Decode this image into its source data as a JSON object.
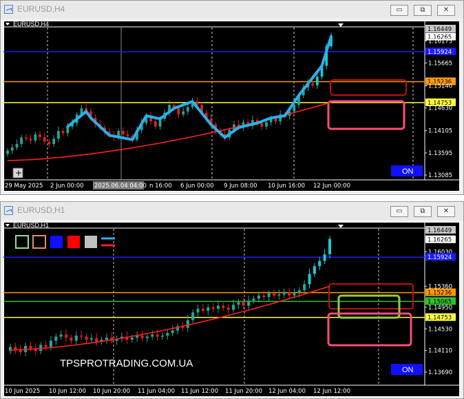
{
  "windows": [
    {
      "id": "h4",
      "title": "EURUSD,H4",
      "symbol_label": "EURUSD,H4",
      "buttons": {
        "minimize": "▭",
        "restore": "⧉",
        "close": "✕"
      },
      "price_scale": [
        "1.16449",
        "1.16265",
        "1.16175",
        "1.15924",
        "1.15665",
        "1.15236",
        "1.15140",
        "1.14753",
        "1.14630",
        "1.14105",
        "1.13595",
        "1.13085"
      ],
      "time_axis": [
        "29 May 2025",
        "2 Jun 00:00",
        "2025.06.04 04:00",
        "n 16:00",
        "6 Jun 00:00",
        "9 Jun 08:00",
        "10 Jun 16:00",
        "12 Jun 00:00"
      ],
      "levels": {
        "blue": "1.15924",
        "orange": "1.15236",
        "yellow": "1.14753"
      },
      "on_button": "ON",
      "chart_data": {
        "type": "candlestick",
        "ylim": [
          1.13085,
          1.16449
        ],
        "closes": [
          1.1365,
          1.1372,
          1.138,
          1.1395,
          1.1392,
          1.1388,
          1.1402,
          1.1396,
          1.1385,
          1.138,
          1.1392,
          1.141,
          1.1405,
          1.142,
          1.1428,
          1.1448,
          1.1462,
          1.1455,
          1.144,
          1.1425,
          1.1418,
          1.1408,
          1.14,
          1.1395,
          1.141,
          1.1402,
          1.1398,
          1.139,
          1.1412,
          1.1428,
          1.1445,
          1.1432,
          1.142,
          1.1438,
          1.1452,
          1.147,
          1.1462,
          1.1448,
          1.1455,
          1.1465,
          1.1478,
          1.147,
          1.1452,
          1.1438,
          1.1425,
          1.141,
          1.1402,
          1.1395,
          1.1412,
          1.1425,
          1.1418,
          1.143,
          1.1422,
          1.1435,
          1.1428,
          1.142,
          1.143,
          1.144,
          1.1432,
          1.1448,
          1.1445,
          1.1455,
          1.147,
          1.1492,
          1.151,
          1.152,
          1.1515,
          1.1535,
          1.156,
          1.1605,
          1.1628
        ],
        "ma_start": 1.1342,
        "ma_end": 1.1476
      }
    },
    {
      "id": "h1",
      "title": "EURUSD,H1",
      "symbol_label": "EURUSD,H1",
      "buttons": {
        "minimize": "▭",
        "restore": "⧉",
        "close": "✕"
      },
      "price_scale": [
        "1.16449",
        "1.16265",
        "1.16030",
        "1.15924",
        "1.15360",
        "1.15236",
        "1.15065",
        "1.14950",
        "1.14753",
        "1.14530",
        "1.14110",
        "1.13690"
      ],
      "time_axis": [
        "10 Jun 2025",
        "10 Jun 12:00",
        "10 Jun 20:00",
        "11 Jun 04:00",
        "11 Jun 12:00",
        "11 Jun 20:00",
        "12 Jun 04:00",
        "12 Jun 12:00"
      ],
      "levels": {
        "blue": "1.15924",
        "orange": "1.15236",
        "green": "1.15065",
        "yellow": "1.14753"
      },
      "watermark": "TPSPROTRADING.COM.UA",
      "on_button": "ON",
      "chart_data": {
        "type": "candlestick",
        "ylim": [
          1.1369,
          1.16449
        ],
        "closes": [
          1.1418,
          1.1412,
          1.1408,
          1.142,
          1.1415,
          1.141,
          1.1422,
          1.1418,
          1.143,
          1.1438,
          1.1442,
          1.1436,
          1.143,
          1.144,
          1.1438,
          1.1432,
          1.1435,
          1.1428,
          1.1432,
          1.1436,
          1.143,
          1.1434,
          1.1438,
          1.1432,
          1.1436,
          1.144,
          1.1435,
          1.1438,
          1.1442,
          1.1438,
          1.144,
          1.1445,
          1.145,
          1.1458,
          1.1455,
          1.147,
          1.1485,
          1.1492,
          1.1488,
          1.1495,
          1.1492,
          1.1498,
          1.1494,
          1.149,
          1.15,
          1.1505,
          1.1498,
          1.1508,
          1.1512,
          1.1518,
          1.1515,
          1.1522,
          1.1518,
          1.152,
          1.1525,
          1.1518,
          1.1522,
          1.1528,
          1.154,
          1.156,
          1.1575,
          1.1585,
          1.1598,
          1.1628
        ],
        "ma_start": 1.1412,
        "ma_end": 1.1536
      }
    }
  ],
  "colors": {
    "bull": "#26a69a",
    "bull_bright": "#1fc8d0",
    "bear": "#e02020",
    "ma": "#ff2020",
    "swing": "#2ab0ea",
    "blue_level": "#1a1aff",
    "orange_level": "#ff9a00",
    "yellow_level": "#ffff40",
    "green_level": "#30c030",
    "zone_red": "#c01010",
    "zone_pink": "#ff4c7a",
    "zone_green": "#90d040",
    "on_bg": "#1010ff"
  },
  "legend_swatches": [
    "outline-green",
    "outline-orange",
    "blue",
    "red",
    "gray"
  ]
}
